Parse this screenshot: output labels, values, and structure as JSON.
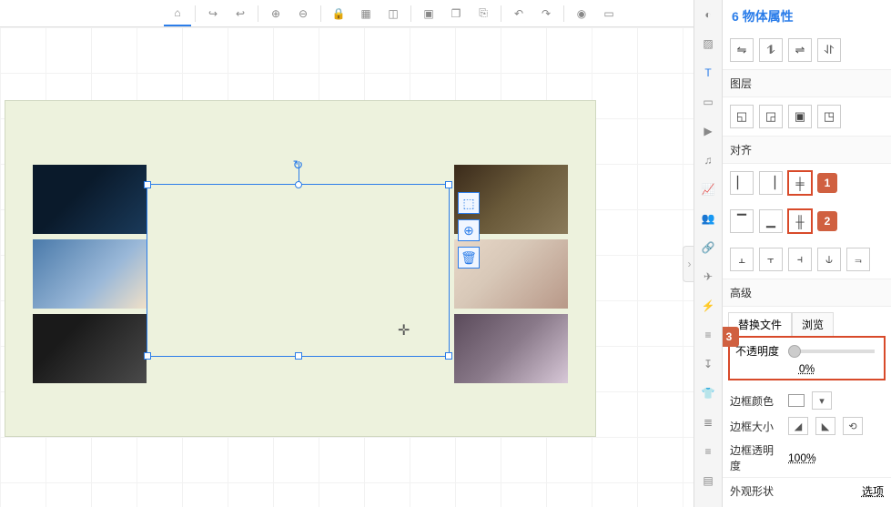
{
  "panel": {
    "title": "6 物体属性",
    "sections": {
      "layer": "图层",
      "align": "对齐",
      "advanced": "高级"
    },
    "tabs": {
      "replace": "替换文件",
      "browse": "浏览"
    },
    "opacity": {
      "label": "不透明度",
      "value": "0%"
    },
    "border_color": "边框颜色",
    "border_size": "边框大小",
    "border_opacity_label": "边框透明度",
    "border_opacity_value": "100%",
    "appearance": "外观形状",
    "options": "选项"
  },
  "markers": {
    "m1": "1",
    "m2": "2",
    "m3": "3"
  },
  "icons": {
    "home": "⌂",
    "redo_arrow": "↪",
    "undo_arrow": "↩",
    "zoom_in": "⊕",
    "zoom_out": "⊖",
    "lock": "🔒",
    "grid": "▦",
    "layout": "◫",
    "stack": "▣",
    "copy": "❐",
    "paste": "⎘",
    "undo": "↶",
    "redo": "↷",
    "camera": "◉",
    "screen": "▭",
    "color": "◐",
    "image": "▨",
    "text": "T",
    "rect": "▭",
    "play": "▶",
    "music": "♫",
    "chart": "📈",
    "people": "👥",
    "link": "🔗",
    "plane": "✈",
    "flash": "⚡",
    "form": "≡",
    "export": "↧",
    "shirt": "👕",
    "layers": "≣",
    "stacks": "≡",
    "archive": "▤",
    "flip_h": "⇋",
    "flip_v": "⥮",
    "flip_h2": "⇌",
    "flip_v2": "⥯",
    "layer1": "◱",
    "layer2": "◲",
    "layer3": "▣",
    "layer4": "◳",
    "al_l": "▏",
    "al_r": "▕",
    "al_c": "╪",
    "al_t": "▔",
    "al_b": "▁",
    "al_m": "╫",
    "dist1": "⫠",
    "dist2": "⫟",
    "dist3": "⫞",
    "dist4": "⫝",
    "dist5": "⫬",
    "size_dec": "◢",
    "size_inc": "◣",
    "size_reset": "⟲",
    "select": "⬚",
    "plus": "⊕",
    "trash": "🗑",
    "rotate": "↻",
    "cross": "✛",
    "chevron": "›",
    "dropdown": "▾"
  }
}
